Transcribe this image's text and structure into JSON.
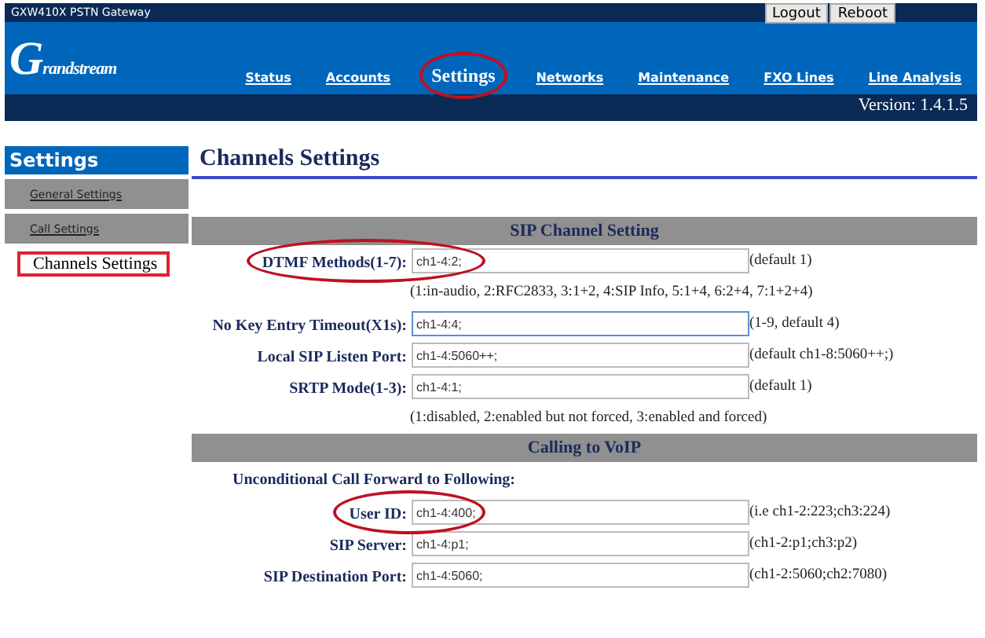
{
  "window": {
    "title": "GXW410X PSTN Gateway"
  },
  "top_buttons": [
    "Logout",
    "Reboot"
  ],
  "logo": "Grandstream",
  "nav": [
    {
      "label": "Status",
      "selected": false,
      "circled": false
    },
    {
      "label": "Accounts",
      "selected": false,
      "circled": false
    },
    {
      "label": "Settings",
      "selected": true,
      "circled": true
    },
    {
      "label": "Networks",
      "selected": false,
      "circled": false
    },
    {
      "label": "Maintenance",
      "selected": false,
      "circled": false
    },
    {
      "label": "FXO Lines",
      "selected": false,
      "circled": false
    },
    {
      "label": "Line Analysis",
      "selected": false,
      "circled": false
    }
  ],
  "version": "Version: 1.4.1.5",
  "sidebar": {
    "title": "Settings",
    "items": [
      {
        "label": "General Settings",
        "selected": false
      },
      {
        "label": "Call Settings",
        "selected": false
      },
      {
        "label": "Channels Settings",
        "selected": true,
        "highlighted": true
      }
    ]
  },
  "page_title": "Channels Settings",
  "sections": [
    {
      "title": "SIP Channel Setting",
      "rows": [
        {
          "kind": "field",
          "label": "DTMF Methods(1-7):",
          "value": "ch1-4:2;",
          "note": "(default 1)",
          "circled": true,
          "focused": false
        },
        {
          "kind": "hint",
          "text": "(1:in-audio, 2:RFC2833, 3:1+2, 4:SIP Info, 5:1+4, 6:2+4, 7:1+2+4)"
        },
        {
          "kind": "field",
          "label": "No Key Entry Timeout(X1s):",
          "value": "ch1-4:4;",
          "note": "(1-9, default 4)",
          "circled": false,
          "focused": true
        },
        {
          "kind": "field",
          "label": "Local SIP Listen Port:",
          "value": "ch1-4:5060++;",
          "note": "(default ch1-8:5060++;)",
          "circled": false,
          "focused": false
        },
        {
          "kind": "field",
          "label": "SRTP Mode(1-3):",
          "value": "ch1-4:1;",
          "note": "(default 1)",
          "circled": false,
          "focused": false
        },
        {
          "kind": "hint",
          "text": "(1:disabled, 2:enabled but not forced, 3:enabled and forced)"
        }
      ]
    },
    {
      "title": "Calling to VoIP",
      "rows": [
        {
          "kind": "subheading",
          "text": "Unconditional Call Forward to Following:"
        },
        {
          "kind": "field",
          "label": "User ID:",
          "value": "ch1-4:400;",
          "note": "(i.e ch1-2:223;ch3:224)",
          "circled": true,
          "focused": false
        },
        {
          "kind": "field",
          "label": "SIP Server:",
          "value": "ch1-4:p1;",
          "note": "(ch1-2:p1;ch3:p2)",
          "circled": false,
          "focused": false
        },
        {
          "kind": "field",
          "label": "SIP Destination Port:",
          "value": "ch1-4:5060;",
          "note": "(ch1-2:5060;ch2:7080)",
          "circled": false,
          "focused": false
        }
      ]
    }
  ]
}
